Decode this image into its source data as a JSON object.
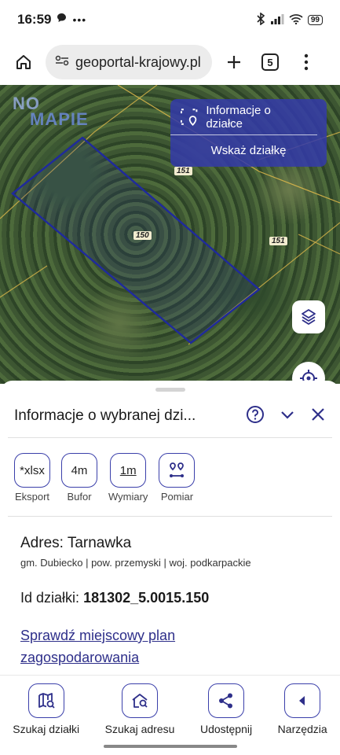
{
  "status": {
    "time": "16:59",
    "battery": "99"
  },
  "browser": {
    "url": "geoportal-krajowy.pl",
    "tabs": "5"
  },
  "map": {
    "logo_line1": "NO",
    "logo_line2": "MAPIE",
    "info_button": "Informacje o działce",
    "show_plot_button": "Wskaż działkę",
    "plot_labels": [
      "151",
      "150",
      "151"
    ]
  },
  "sheet": {
    "title": "Informacje o wybranej dzi...",
    "tools": [
      {
        "value": "*xlsx",
        "label": "Eksport"
      },
      {
        "value": "4m",
        "label": "Bufor"
      },
      {
        "value": "1m",
        "label": "Wymiary"
      },
      {
        "value": "",
        "label": "Pomiar"
      }
    ],
    "address_title": "Adres: Tarnawka",
    "address_sub": "gm. Dubiecko | pow. przemyski | woj. podkarpackie",
    "plot_id_label": "Id działki:",
    "plot_id_value": "181302_5.0015.150",
    "plan_link": "Sprawdź miejscowy plan zagospodarowania"
  },
  "nav": [
    {
      "label": "Szukaj działki",
      "icon": "map-search-icon"
    },
    {
      "label": "Szukaj adresu",
      "icon": "home-search-icon"
    },
    {
      "label": "Udostępnij",
      "icon": "share-icon"
    },
    {
      "label": "Narzędzia",
      "icon": "tools-icon"
    }
  ],
  "colors": {
    "accent": "#3a3faa",
    "panel": "#343aaa",
    "plot_outline": "#1f2a9c"
  }
}
